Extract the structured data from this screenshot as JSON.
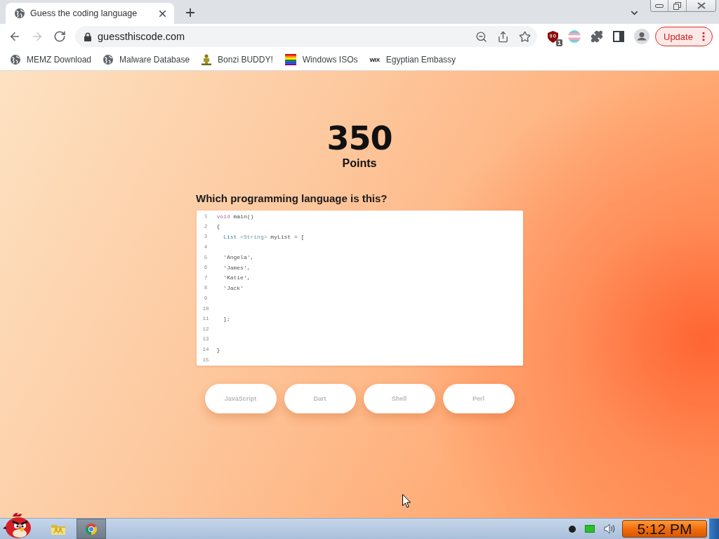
{
  "browser": {
    "tabs": [
      {
        "title": "Guess the coding language",
        "selected": true
      }
    ],
    "nav_buttons": [
      {
        "kind": "back",
        "disabled": false
      },
      {
        "kind": "forward",
        "disabled": true
      },
      {
        "kind": "reload",
        "disabled": false
      }
    ],
    "address": "guessthiscode.com",
    "extensions": [
      {
        "kind": "shield",
        "badge": "1"
      },
      {
        "kind": "striped"
      },
      {
        "kind": "puzzle"
      },
      {
        "kind": "sidepanel"
      },
      {
        "kind": "profile"
      }
    ],
    "update_button": "Update",
    "bookmarks": [
      {
        "kind": "globe",
        "label": "MEMZ Download"
      },
      {
        "kind": "globe",
        "label": "Malware Database"
      },
      {
        "kind": "figure",
        "label": "Bonzi BUDDY!"
      },
      {
        "kind": "rainbow",
        "label": "Windows ISOs"
      },
      {
        "kind": "wordmark",
        "favicon_text": "WIX",
        "label": "Egyptian Embassy"
      }
    ]
  },
  "page": {
    "score": "350",
    "score_label": "Points",
    "question": "Which programming language is this?",
    "code_lines": [
      {
        "number": "1",
        "tokens": [
          {
            "kind": "keyword",
            "text": "void"
          },
          {
            "kind": "plain",
            "text": " main()"
          }
        ]
      },
      {
        "number": "2",
        "tokens": [
          {
            "kind": "plain",
            "text": "{"
          }
        ]
      },
      {
        "number": "3",
        "tokens": [
          {
            "kind": "type",
            "text": "  List"
          },
          {
            "kind": "generic",
            "text": " <String>"
          },
          {
            "kind": "plain",
            "text": " myList = ["
          }
        ]
      },
      {
        "number": "4"
      },
      {
        "number": "5",
        "tokens": [
          {
            "kind": "string",
            "text": "  'Angela',"
          }
        ]
      },
      {
        "number": "6",
        "tokens": [
          {
            "kind": "string",
            "text": "  'James',"
          }
        ]
      },
      {
        "number": "7",
        "tokens": [
          {
            "kind": "string",
            "text": "  'Katie',"
          }
        ]
      },
      {
        "number": "8",
        "tokens": [
          {
            "kind": "string",
            "text": "  'Jack'"
          }
        ]
      },
      {
        "number": "9"
      },
      {
        "number": "10"
      },
      {
        "number": "11",
        "tokens": [
          {
            "kind": "plain",
            "text": "  ];"
          }
        ]
      },
      {
        "number": "12"
      },
      {
        "number": "13"
      },
      {
        "number": "14",
        "tokens": [
          {
            "kind": "plain",
            "text": "}"
          }
        ]
      },
      {
        "number": "15"
      }
    ],
    "answers": [
      {
        "label": "JavaScript"
      },
      {
        "label": "Dart"
      },
      {
        "label": "Shell"
      },
      {
        "label": "Perl"
      }
    ]
  },
  "taskbar": {
    "apps": [
      {
        "kind": "folder",
        "selected": false
      },
      {
        "kind": "chrome",
        "selected": true
      }
    ],
    "tray": [
      {
        "kind": "dot"
      },
      {
        "kind": "screen"
      },
      {
        "kind": "volume"
      }
    ],
    "clock": "5:12 PM"
  }
}
